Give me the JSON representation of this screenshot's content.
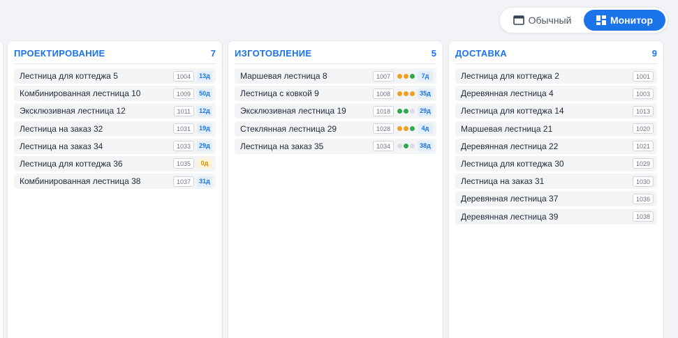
{
  "view_toggle": {
    "normal_label": "Обычный",
    "monitor_label": "Монитор",
    "active": "monitor"
  },
  "colors": {
    "accent": "#1a73e8",
    "dot_orange": "#f0a020",
    "dot_green": "#2fa84f",
    "dot_gray": "#d9dde3",
    "days_amber": "#d39200"
  },
  "columns": [
    {
      "title": "ПРОЕКТИРОВАНИЕ",
      "count": "7",
      "cards": [
        {
          "name": "Лестница для коттеджа 5",
          "id": "1004",
          "days": "13д",
          "days_style": "blue",
          "dots": []
        },
        {
          "name": "Комбинированная лестница 10",
          "id": "1009",
          "days": "50д",
          "days_style": "blue",
          "dots": []
        },
        {
          "name": "Эксклюзивная лестница 12",
          "id": "1011",
          "days": "12д",
          "days_style": "blue",
          "dots": []
        },
        {
          "name": "Лестница на заказ 32",
          "id": "1031",
          "days": "19д",
          "days_style": "blue",
          "dots": []
        },
        {
          "name": "Лестница на заказ 34",
          "id": "1033",
          "days": "29д",
          "days_style": "blue",
          "dots": []
        },
        {
          "name": "Лестница для коттеджа 36",
          "id": "1035",
          "days": "0д",
          "days_style": "amber",
          "dots": []
        },
        {
          "name": "Комбинированная лестница 38",
          "id": "1037",
          "days": "31д",
          "days_style": "blue",
          "dots": []
        }
      ]
    },
    {
      "title": "ИЗГОТОВЛЕНИЕ",
      "count": "5",
      "cards": [
        {
          "name": "Маршевая лестница 8",
          "id": "1007",
          "days": "7д",
          "days_style": "blue",
          "dots": [
            "orange",
            "orange",
            "green"
          ]
        },
        {
          "name": "Лестница с ковкой 9",
          "id": "1008",
          "days": "35д",
          "days_style": "blue",
          "dots": [
            "orange",
            "orange",
            "orange"
          ]
        },
        {
          "name": "Эксклюзивная лестница 19",
          "id": "1018",
          "days": "29д",
          "days_style": "blue",
          "dots": [
            "green",
            "green",
            "gray"
          ]
        },
        {
          "name": "Стеклянная лестница 29",
          "id": "1028",
          "days": "4д",
          "days_style": "blue",
          "dots": [
            "orange",
            "orange",
            "green"
          ]
        },
        {
          "name": "Лестница на заказ 35",
          "id": "1034",
          "days": "38д",
          "days_style": "blue",
          "dots": [
            "gray",
            "green",
            "gray"
          ]
        }
      ]
    },
    {
      "title": "ДОСТАВКА",
      "count": "9",
      "cards": [
        {
          "name": "Лестница для коттеджа 2",
          "id": "1001",
          "days": "",
          "days_style": "",
          "dots": []
        },
        {
          "name": "Деревянная лестница 4",
          "id": "1003",
          "days": "",
          "days_style": "",
          "dots": []
        },
        {
          "name": "Лестница для коттеджа 14",
          "id": "1013",
          "days": "",
          "days_style": "",
          "dots": []
        },
        {
          "name": "Маршевая лестница 21",
          "id": "1020",
          "days": "",
          "days_style": "",
          "dots": []
        },
        {
          "name": "Деревянная лестница 22",
          "id": "1021",
          "days": "",
          "days_style": "",
          "dots": []
        },
        {
          "name": "Лестница для коттеджа 30",
          "id": "1029",
          "days": "",
          "days_style": "",
          "dots": []
        },
        {
          "name": "Лестница на заказ 31",
          "id": "1030",
          "days": "",
          "days_style": "",
          "dots": []
        },
        {
          "name": "Деревянная лестница 37",
          "id": "1036",
          "days": "",
          "days_style": "",
          "dots": []
        },
        {
          "name": "Деревянная лестница 39",
          "id": "1038",
          "days": "",
          "days_style": "",
          "dots": []
        }
      ]
    }
  ]
}
